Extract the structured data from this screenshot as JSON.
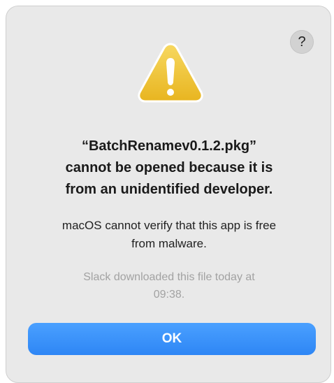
{
  "dialog": {
    "help_label": "?",
    "icon": "warning-triangle-icon",
    "title_lines": [
      "“BatchRenamev0.1.2.pkg”",
      "cannot be opened because it is",
      "from an unidentified developer."
    ],
    "message_lines": [
      "macOS cannot verify that this app is free",
      "from malware."
    ],
    "source_lines": [
      "Slack downloaded this file today at",
      "09:38."
    ],
    "ok_label": "OK"
  },
  "colors": {
    "background": "#e9e9e9",
    "accent": "#2e86f5",
    "warning": "#f2c531"
  }
}
